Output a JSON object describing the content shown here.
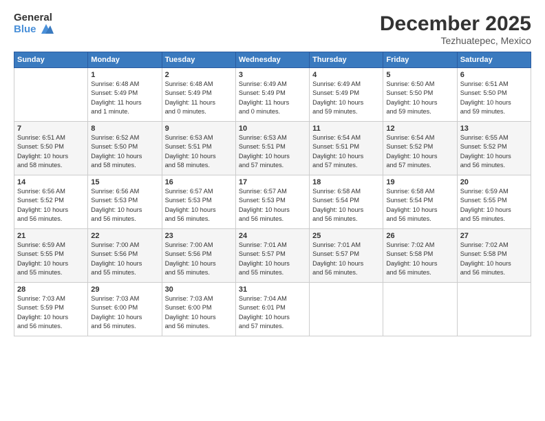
{
  "logo": {
    "general": "General",
    "blue": "Blue"
  },
  "header": {
    "month": "December 2025",
    "location": "Tezhuatepec, Mexico"
  },
  "weekdays": [
    "Sunday",
    "Monday",
    "Tuesday",
    "Wednesday",
    "Thursday",
    "Friday",
    "Saturday"
  ],
  "weeks": [
    [
      {
        "day": "",
        "content": ""
      },
      {
        "day": "1",
        "content": "Sunrise: 6:48 AM\nSunset: 5:49 PM\nDaylight: 11 hours\nand 1 minute."
      },
      {
        "day": "2",
        "content": "Sunrise: 6:48 AM\nSunset: 5:49 PM\nDaylight: 11 hours\nand 0 minutes."
      },
      {
        "day": "3",
        "content": "Sunrise: 6:49 AM\nSunset: 5:49 PM\nDaylight: 11 hours\nand 0 minutes."
      },
      {
        "day": "4",
        "content": "Sunrise: 6:49 AM\nSunset: 5:49 PM\nDaylight: 10 hours\nand 59 minutes."
      },
      {
        "day": "5",
        "content": "Sunrise: 6:50 AM\nSunset: 5:50 PM\nDaylight: 10 hours\nand 59 minutes."
      },
      {
        "day": "6",
        "content": "Sunrise: 6:51 AM\nSunset: 5:50 PM\nDaylight: 10 hours\nand 59 minutes."
      }
    ],
    [
      {
        "day": "7",
        "content": "Sunrise: 6:51 AM\nSunset: 5:50 PM\nDaylight: 10 hours\nand 58 minutes."
      },
      {
        "day": "8",
        "content": "Sunrise: 6:52 AM\nSunset: 5:50 PM\nDaylight: 10 hours\nand 58 minutes."
      },
      {
        "day": "9",
        "content": "Sunrise: 6:53 AM\nSunset: 5:51 PM\nDaylight: 10 hours\nand 58 minutes."
      },
      {
        "day": "10",
        "content": "Sunrise: 6:53 AM\nSunset: 5:51 PM\nDaylight: 10 hours\nand 57 minutes."
      },
      {
        "day": "11",
        "content": "Sunrise: 6:54 AM\nSunset: 5:51 PM\nDaylight: 10 hours\nand 57 minutes."
      },
      {
        "day": "12",
        "content": "Sunrise: 6:54 AM\nSunset: 5:52 PM\nDaylight: 10 hours\nand 57 minutes."
      },
      {
        "day": "13",
        "content": "Sunrise: 6:55 AM\nSunset: 5:52 PM\nDaylight: 10 hours\nand 56 minutes."
      }
    ],
    [
      {
        "day": "14",
        "content": "Sunrise: 6:56 AM\nSunset: 5:52 PM\nDaylight: 10 hours\nand 56 minutes."
      },
      {
        "day": "15",
        "content": "Sunrise: 6:56 AM\nSunset: 5:53 PM\nDaylight: 10 hours\nand 56 minutes."
      },
      {
        "day": "16",
        "content": "Sunrise: 6:57 AM\nSunset: 5:53 PM\nDaylight: 10 hours\nand 56 minutes."
      },
      {
        "day": "17",
        "content": "Sunrise: 6:57 AM\nSunset: 5:53 PM\nDaylight: 10 hours\nand 56 minutes."
      },
      {
        "day": "18",
        "content": "Sunrise: 6:58 AM\nSunset: 5:54 PM\nDaylight: 10 hours\nand 56 minutes."
      },
      {
        "day": "19",
        "content": "Sunrise: 6:58 AM\nSunset: 5:54 PM\nDaylight: 10 hours\nand 56 minutes."
      },
      {
        "day": "20",
        "content": "Sunrise: 6:59 AM\nSunset: 5:55 PM\nDaylight: 10 hours\nand 55 minutes."
      }
    ],
    [
      {
        "day": "21",
        "content": "Sunrise: 6:59 AM\nSunset: 5:55 PM\nDaylight: 10 hours\nand 55 minutes."
      },
      {
        "day": "22",
        "content": "Sunrise: 7:00 AM\nSunset: 5:56 PM\nDaylight: 10 hours\nand 55 minutes."
      },
      {
        "day": "23",
        "content": "Sunrise: 7:00 AM\nSunset: 5:56 PM\nDaylight: 10 hours\nand 55 minutes."
      },
      {
        "day": "24",
        "content": "Sunrise: 7:01 AM\nSunset: 5:57 PM\nDaylight: 10 hours\nand 55 minutes."
      },
      {
        "day": "25",
        "content": "Sunrise: 7:01 AM\nSunset: 5:57 PM\nDaylight: 10 hours\nand 56 minutes."
      },
      {
        "day": "26",
        "content": "Sunrise: 7:02 AM\nSunset: 5:58 PM\nDaylight: 10 hours\nand 56 minutes."
      },
      {
        "day": "27",
        "content": "Sunrise: 7:02 AM\nSunset: 5:58 PM\nDaylight: 10 hours\nand 56 minutes."
      }
    ],
    [
      {
        "day": "28",
        "content": "Sunrise: 7:03 AM\nSunset: 5:59 PM\nDaylight: 10 hours\nand 56 minutes."
      },
      {
        "day": "29",
        "content": "Sunrise: 7:03 AM\nSunset: 6:00 PM\nDaylight: 10 hours\nand 56 minutes."
      },
      {
        "day": "30",
        "content": "Sunrise: 7:03 AM\nSunset: 6:00 PM\nDaylight: 10 hours\nand 56 minutes."
      },
      {
        "day": "31",
        "content": "Sunrise: 7:04 AM\nSunset: 6:01 PM\nDaylight: 10 hours\nand 57 minutes."
      },
      {
        "day": "",
        "content": ""
      },
      {
        "day": "",
        "content": ""
      },
      {
        "day": "",
        "content": ""
      }
    ]
  ]
}
